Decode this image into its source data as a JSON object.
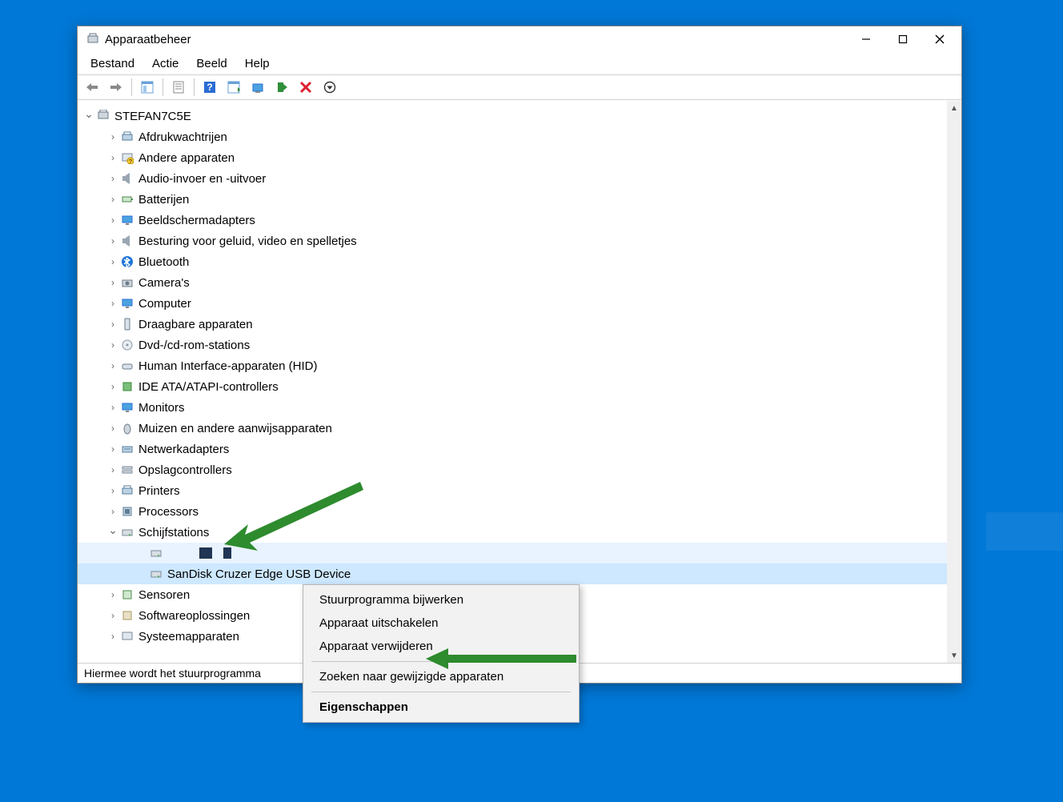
{
  "window": {
    "title": "Apparaatbeheer",
    "menu": [
      "Bestand",
      "Actie",
      "Beeld",
      "Help"
    ],
    "root": "STEFAN7C5E"
  },
  "categories": [
    "Afdrukwachtrijen",
    "Andere apparaten",
    "Audio-invoer en -uitvoer",
    "Batterijen",
    "Beeldschermadapters",
    "Besturing voor geluid, video en spelletjes",
    "Bluetooth",
    "Camera's",
    "Computer",
    "Draagbare apparaten",
    "Dvd-/cd-rom-stations",
    "Human Interface-apparaten (HID)",
    "IDE ATA/ATAPI-controllers",
    "Monitors",
    "Muizen en andere aanwijsapparaten",
    "Netwerkadapters",
    "Opslagcontrollers",
    "Printers",
    "Processors"
  ],
  "disk": {
    "category": "Schijfstations",
    "child_hidden": "",
    "child_selected": "SanDisk Cruzer Edge USB Device"
  },
  "tail": [
    "Sensoren",
    "Softwareoplossingen",
    "Systeemapparaten"
  ],
  "context_menu": {
    "items": [
      "Stuurprogramma bijwerken",
      "Apparaat uitschakelen",
      "Apparaat verwijderen"
    ],
    "item_after_sep": "Zoeken naar gewijzigde apparaten",
    "default_item": "Eigenschappen"
  },
  "statusbar": "Hiermee wordt het stuurprogramma",
  "colors": {
    "accent": "#0078d7",
    "arrow": "#2e8b2e"
  }
}
